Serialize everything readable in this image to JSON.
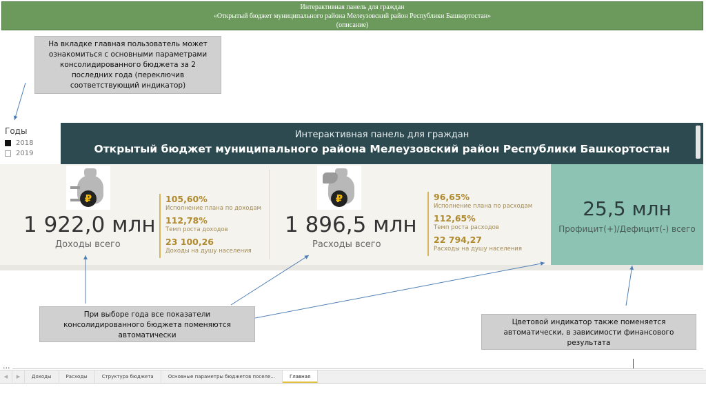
{
  "banner": {
    "line1": "Интерактивная панель для граждан",
    "line2": "«Открытый бюджет муниципального района Мелеузовский район Республики Башкортостан»",
    "line3": "(описание)"
  },
  "callouts": {
    "home_tab_note": "На вкладке главная пользователь может ознакомиться с основными параметрами консолидированного бюджета за 2 последних года (переключив соответствующий индикатор)",
    "year_change_note": "При выборе года все показатели консолидированного бюджета поменяются автоматически",
    "color_note": "Цветовой индикатор также поменяется автоматически, в зависимости финансового результата"
  },
  "years_filter": {
    "title": "Годы",
    "options": [
      {
        "label": "2018",
        "checked": true
      },
      {
        "label": "2019",
        "checked": false
      }
    ]
  },
  "dashboard": {
    "subtitle": "Интерактивная панель для граждан",
    "title": "Открытый бюджет муниципального района Мелеузовский район Республики Башкортостан"
  },
  "revenue": {
    "icon": "money-bag-ruble-icon",
    "value": "1 922,0 млн",
    "label": "Доходы всего",
    "kpis": [
      {
        "value": "105,60%",
        "label": "Исполнение плана по доходам"
      },
      {
        "value": "112,78%",
        "label": "Темп роста доходов"
      },
      {
        "value": "23 100,26",
        "label": "Доходы на душу населения"
      }
    ]
  },
  "expenses": {
    "icon": "hand-money-bag-ruble-icon",
    "value": "1 896,5 млн",
    "label": "Расходы всего",
    "kpis": [
      {
        "value": "96,65%",
        "label": "Исполнение плана по расходам"
      },
      {
        "value": "112,65%",
        "label": "Темп роста расходов"
      },
      {
        "value": "22 794,27",
        "label": "Расходы на душу населения"
      }
    ]
  },
  "result": {
    "value": "25,5 млн",
    "label": "Профицит(+)/Дефицит(-) всего",
    "color": "#8cc3b2"
  },
  "tabbar": {
    "more": "...",
    "tabs": [
      {
        "label": "Доходы",
        "active": false
      },
      {
        "label": "Расходы",
        "active": false
      },
      {
        "label": "Структура бюджета",
        "active": false
      },
      {
        "label": "Основные параметры бюджетов поселе...",
        "active": false
      },
      {
        "label": "Главная",
        "active": true
      }
    ]
  },
  "colors": {
    "banner": "#6b9a5c",
    "header": "#2d4a50",
    "kpi_accent": "#b08a2e",
    "arrow": "#4f7fb5"
  }
}
